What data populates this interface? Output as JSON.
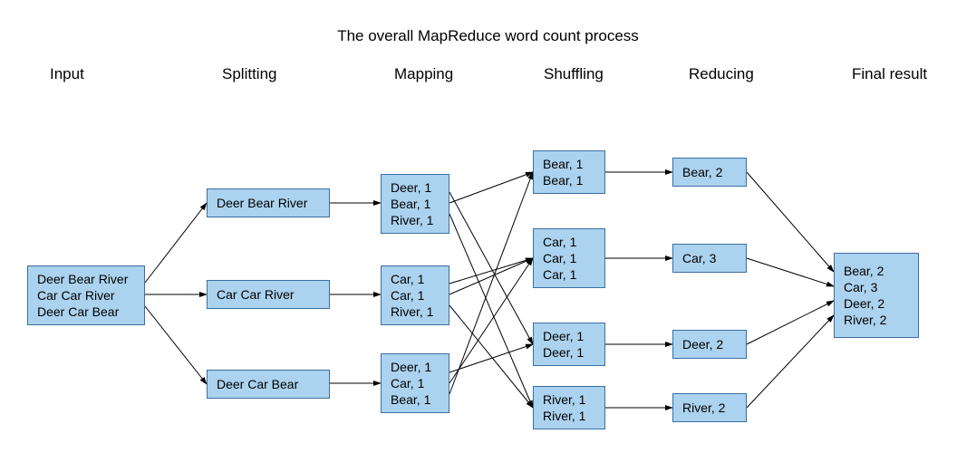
{
  "title": "The overall MapReduce word count process",
  "stages": [
    "Input",
    "Splitting",
    "Mapping",
    "Shuffling",
    "Reducing",
    "Final result"
  ],
  "input": {
    "lines": [
      "Deer Bear River",
      "Car Car River",
      "Deer Car Bear"
    ]
  },
  "splitting": [
    "Deer Bear River",
    "Car Car River",
    "Deer Car Bear"
  ],
  "mapping": [
    [
      "Deer, 1",
      "Bear, 1",
      "River, 1"
    ],
    [
      "Car, 1",
      "Car, 1",
      "River, 1"
    ],
    [
      "Deer, 1",
      "Car, 1",
      "Bear, 1"
    ]
  ],
  "shuffling": [
    [
      "Bear, 1",
      "Bear, 1"
    ],
    [
      "Car, 1",
      "Car, 1",
      "Car, 1"
    ],
    [
      "Deer, 1",
      "Deer, 1"
    ],
    [
      "River, 1",
      "River, 1"
    ]
  ],
  "reducing": [
    "Bear, 2",
    "Car, 3",
    "Deer, 2",
    "River, 2"
  ],
  "final": [
    "Bear, 2",
    "Car, 3",
    "Deer, 2",
    "River, 2"
  ]
}
